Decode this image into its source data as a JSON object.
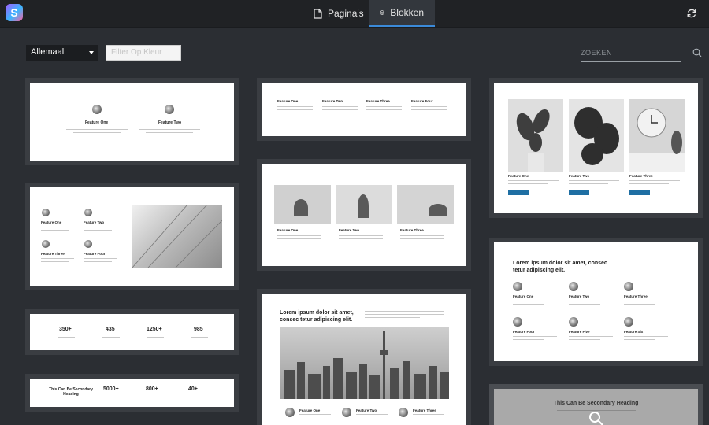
{
  "header": {
    "logo_letter": "S",
    "tab_pages": "Pagina's",
    "tab_blocks": "Blokken"
  },
  "toolbar": {
    "filter_select": "Allemaal",
    "filter_color_placeholder": "Filter Op Kleur",
    "search_placeholder": "ZOEKEN"
  },
  "blocks": {
    "b1": {
      "f1": "Feature One",
      "f2": "Feature Two"
    },
    "b2": {
      "f1": "Feature One",
      "f2": "Feature Two",
      "f3": "Feature Three",
      "f4": "Feature Four"
    },
    "b3": {
      "stats": [
        "350+",
        "435",
        "1250+",
        "985"
      ]
    },
    "b4": {
      "heading": "This Can Be Secondary Heading",
      "stats": [
        "5000+",
        "800+",
        "40+"
      ]
    },
    "b5": {
      "f1": "Feature One",
      "f2": "Feature Two",
      "f3": "Feature Three",
      "f4": "Feature Four"
    },
    "b6": {
      "f1": "Feature One",
      "f2": "Feature Two",
      "f3": "Feature Three"
    },
    "b7": {
      "heading": "Lorem ipsum dolor sit amet, consec tetur adipiscing elit.",
      "f1": "Feature One",
      "f2": "Feature Two",
      "f3": "Feature Three"
    },
    "b8": {
      "f1": "Feature One",
      "f2": "Feature Two",
      "f3": "Feature Three"
    },
    "b9": {
      "heading": "Lorem ipsum dolor sit amet, consec tetur adipiscing elit.",
      "f1": "Feature One",
      "f2": "Feature Two",
      "f3": "Feature Three",
      "f4": "Feature Four",
      "f5": "Feature Five",
      "f6": "Feature Six"
    },
    "b10": {
      "heading": "This Can Be Secondary Heading"
    }
  }
}
